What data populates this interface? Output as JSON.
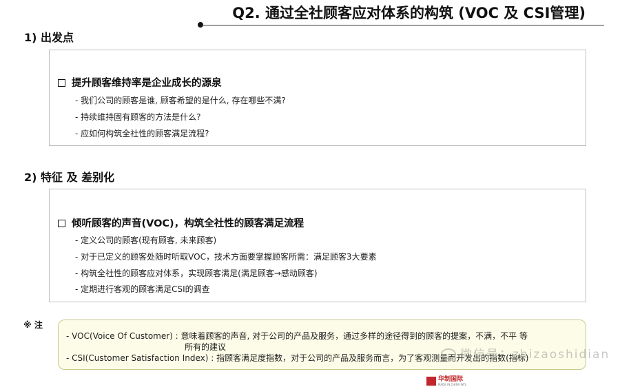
{
  "title": "Q2.   通过全社顾客应对体系的构筑 (VOC 及 CSI管理)",
  "section1": {
    "heading": "1)  出发点",
    "box_heading": "提升顾客维持率是企业成长的源泉",
    "items": [
      "- 我们公司的顾客是谁, 顾客希望的是什么, 存在哪些不满?",
      "- 持续维持固有顾客的方法是什么?",
      "- 应如何构筑全社性的顾客满足流程?"
    ]
  },
  "section2": {
    "heading": "2) 特征 及 差别化",
    "box_heading": "倾听顾客的声音(VOC)，构筑全社性的顾客满足流程",
    "items": [
      "- 定义公司的顾客(现有顾客, 未来顾客)",
      "- 对于已定义的顾客处随时听取VOC，技术方面要掌握顾客所需：满足顾客3大要素",
      "- 构筑全社性的顾客应对体系，实现顾客满足(满足顾客→感动顾客)",
      "- 定期进行客观的顾客满足CSI的调查"
    ]
  },
  "note": {
    "label": "※ 注",
    "lines": [
      "- VOC(Voice Of Customer) : 意味着顾客的声音, 对于公司的产品及服务，通过多样的途径得到的顾客的提案，不满，不平 等",
      "所有的建议",
      "- CSI(Customer Satisfaction Index) : 指顾客满足度指数，对于公司的产品及服务而言，为了客观测量而开发出的指数(指标)"
    ]
  },
  "watermark": "微信号：zhizaoshidian",
  "logo": {
    "name": "华制国际",
    "sub": "MADE IN CHINA INTL"
  }
}
